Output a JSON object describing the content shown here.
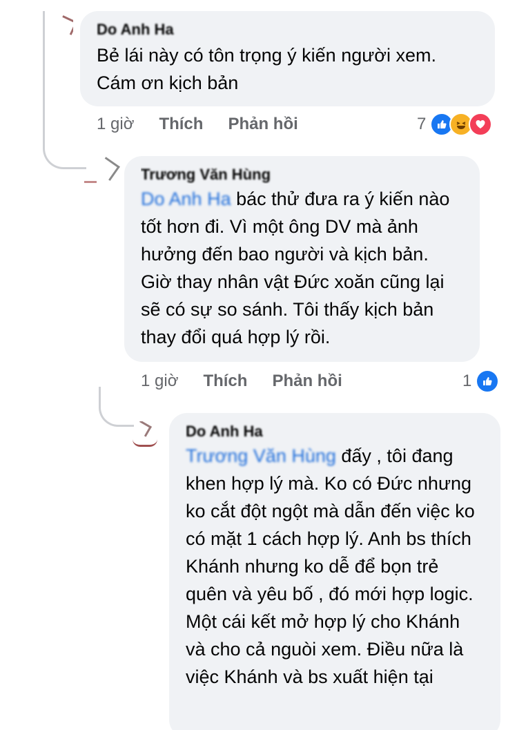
{
  "comments": [
    {
      "author": "Do Anh Ha",
      "text": "Bẻ lái này có tôn trọng ý kiến người xem.\nCám ơn kịch bản",
      "time": "1 giờ",
      "like_label": "Thích",
      "reply_label": "Phản hồi",
      "reaction_count": "7",
      "reactions": [
        "like-icon",
        "haha-icon",
        "love-icon"
      ]
    },
    {
      "author": "Trương Văn Hùng",
      "mention": "Do Anh Ha",
      "text": " bác thử đưa ra ý kiến nào tốt hơn đi. Vì một ông DV mà ảnh hưởng đến bao người và kịch bản. Giờ thay nhân vật Đức xoăn cũng lại sẽ có sự so sánh. Tôi thấy kịch bản thay đổi quá hợp lý rồi.",
      "time": "1 giờ",
      "like_label": "Thích",
      "reply_label": "Phản hồi",
      "reaction_count": "1",
      "reactions": [
        "like-icon"
      ]
    },
    {
      "author": "Do Anh Ha",
      "mention": "Trương Văn Hùng",
      "text": " đấy , tôi đang khen hợp lý mà. Ko có Đức nhưng ko cắt đột ngột mà dẫn đến việc ko có mặt 1 cách hợp lý. Anh bs thích Khánh nhưng ko dễ để bọn trẻ quên và yêu bố , đó mới hợp logic. Một cái kết mở hợp lý cho Khánh và cho cả nguòi xem. Điều nữa là việc Khánh và bs xuất hiện tại"
    }
  ],
  "colors": {
    "bubble": "#f0f2f5",
    "link": "#216fdb",
    "meta": "#65676b",
    "like": "#1877f2",
    "haha": "#f7b125",
    "love": "#f33e58"
  }
}
